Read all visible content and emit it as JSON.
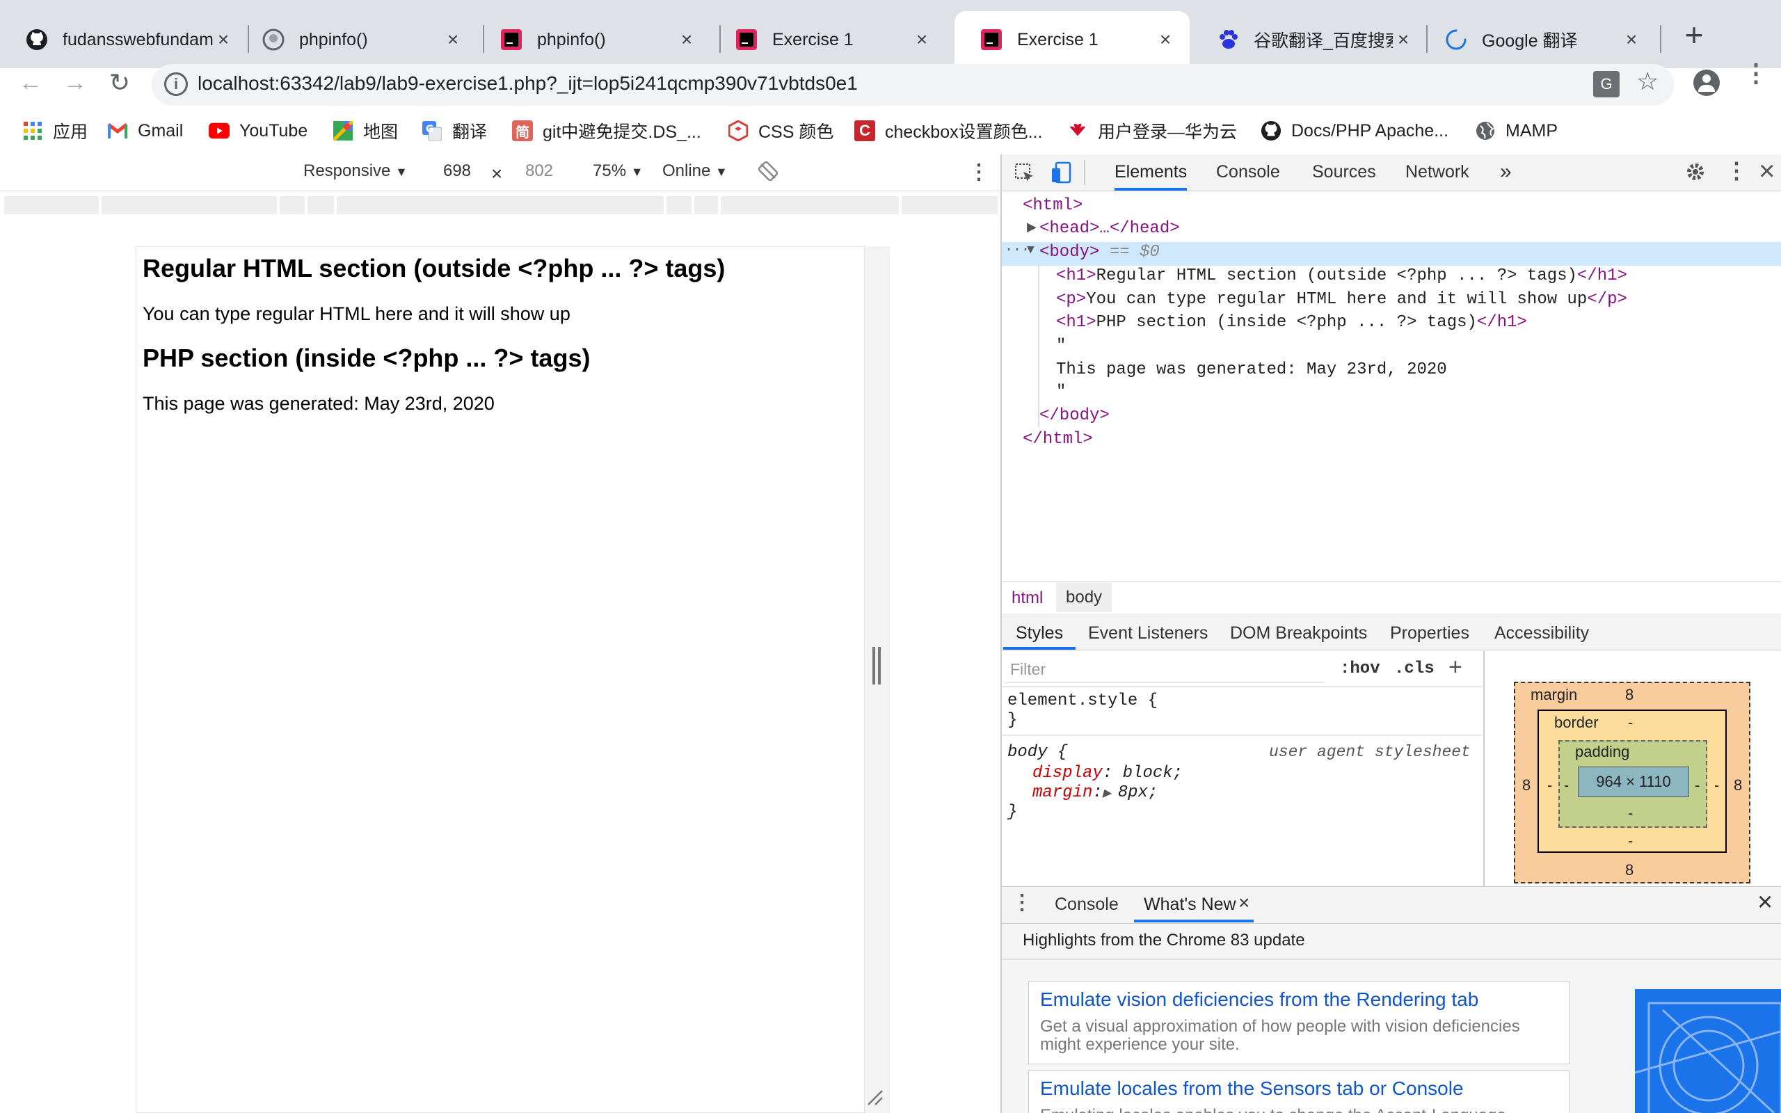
{
  "browser": {
    "tabs": [
      {
        "title": "fudansswebfundamental",
        "favicon": "github-icon"
      },
      {
        "title": "phpinfo()",
        "favicon": "php-icon"
      },
      {
        "title": "phpinfo()",
        "favicon": "jetbrains-icon"
      },
      {
        "title": "Exercise 1",
        "favicon": "jetbrains-icon"
      },
      {
        "title": "Exercise 1",
        "favicon": "jetbrains-icon",
        "active": true
      },
      {
        "title": "谷歌翻译_百度搜索",
        "favicon": "baidu-icon"
      },
      {
        "title": "Google 翻译",
        "favicon": "loading-icon"
      }
    ],
    "new_tab": "+",
    "url": "localhost:63342/lab9/lab9-exercise1.php?_ijt=lop5i241qcmp390v71vbtds0e1",
    "bookmarks": [
      "应用",
      "Gmail",
      "YouTube",
      "地图",
      "翻译",
      "git中避免提交.DS_...",
      "CSS 颜色",
      "checkbox设置颜色...",
      "用户登录—华为云",
      "Docs/PHP Apache...",
      "MAMP"
    ]
  },
  "device_toolbar": {
    "mode": "Responsive",
    "width": "698",
    "height": "802",
    "zoom": "75%",
    "network": "Online"
  },
  "page": {
    "h1_regular": "Regular HTML section (outside <?php ... ?> tags)",
    "p": "You can type regular HTML here and it will show up",
    "h1_php": "PHP section (inside <?php ... ?> tags)",
    "generated": "This page was generated: May 23rd, 2020"
  },
  "devtools": {
    "tabs": [
      "Elements",
      "Console",
      "Sources",
      "Network",
      "»"
    ],
    "dom": {
      "html_open": "<html>",
      "head": "<head>…</head>",
      "body_open": "<body>",
      "body_eq": " == $0",
      "h1_text": "Regular HTML section (outside <?php ... ?> tags)",
      "p_text": "You can type regular HTML here and it will show up",
      "h1b_text": "PHP section (inside <?php ... ?> tags)",
      "quote": "\"",
      "text_node": "This page was generated: May 23rd, 2020",
      "body_close": "</body>",
      "html_close": "</html>"
    },
    "breadcrumbs": [
      "html",
      "body"
    ],
    "styles_tabs": [
      "Styles",
      "Event Listeners",
      "DOM Breakpoints",
      "Properties",
      "Accessibility"
    ],
    "filter_placeholder": "Filter",
    "hov": ":hov",
    "cls": ".cls",
    "rules": {
      "element_style": "element.style {",
      "close_brace": "}",
      "body_selector": "body {",
      "source": "user agent stylesheet",
      "display_prop": "display",
      "display_val": "block;",
      "margin_prop": "margin",
      "margin_val": "8px;"
    },
    "box_model": {
      "margin_label": "margin",
      "margin_top": "8",
      "margin_left": "8",
      "margin_right": "8",
      "margin_bottom": "8",
      "border_label": "border",
      "border_dash": "-",
      "padding_label": "padding",
      "size": "964 × 1110"
    },
    "drawer": {
      "tabs": [
        "Console",
        "What's New"
      ],
      "heading": "Highlights from the Chrome 83 update",
      "cards": [
        {
          "title": "Emulate vision deficiencies from the Rendering tab",
          "desc": "Get a visual approximation of how people with vision deficiencies might experience your site."
        },
        {
          "title": "Emulate locales from the Sensors tab or Console",
          "desc": "Emulating locales enables you to change the Accept-Language"
        }
      ]
    }
  }
}
